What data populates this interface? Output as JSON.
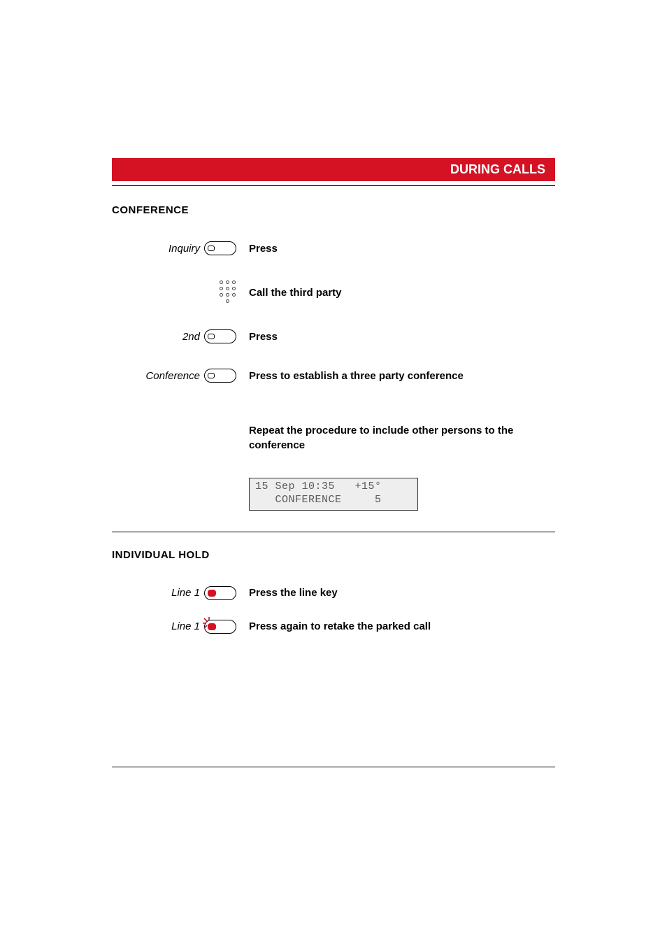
{
  "header": {
    "title": "DURING CALLS"
  },
  "section1": {
    "title": "CONFERENCE",
    "steps": [
      {
        "label": "Inquiry",
        "instr": "Press"
      },
      {
        "label": "",
        "instr": "Call the third party"
      },
      {
        "label": "2nd",
        "instr": "Press"
      },
      {
        "label": "Conference",
        "instr": "Press to establish a three party conference"
      }
    ],
    "repeat_note": "Repeat the procedure to include other persons to the conference",
    "lcd_line1": "15 Sep 10:35   +15°",
    "lcd_line2": "   CONFERENCE     5"
  },
  "section2": {
    "title": "INDIVIDUAL HOLD",
    "steps": [
      {
        "label": "Line 1",
        "instr": "Press the line key"
      },
      {
        "label": "Line 1",
        "instr": "Press again to retake the parked call"
      }
    ]
  }
}
